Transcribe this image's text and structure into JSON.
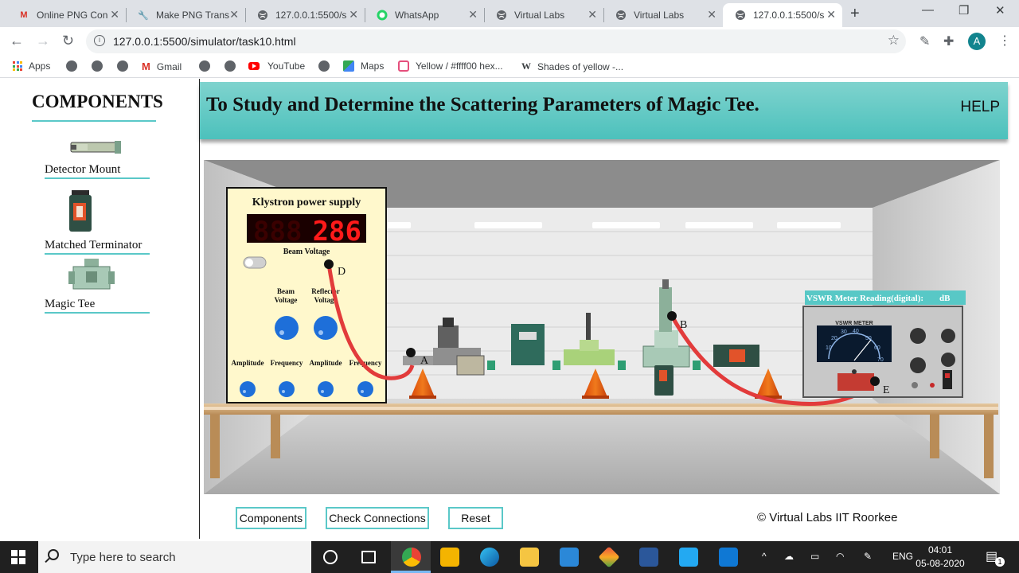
{
  "browser": {
    "tabs": [
      {
        "title": "Online PNG Con",
        "icon": "gmail-icon",
        "active": false
      },
      {
        "title": "Make PNG Trans",
        "icon": "wrench-icon",
        "active": false
      },
      {
        "title": "127.0.0.1:5500/s",
        "icon": "globe-icon",
        "active": false
      },
      {
        "title": "WhatsApp",
        "icon": "whatsapp-icon",
        "active": false
      },
      {
        "title": "Virtual Labs",
        "icon": "globe-icon",
        "active": false
      },
      {
        "title": "Virtual Labs",
        "icon": "globe-icon",
        "active": false
      },
      {
        "title": "127.0.0.1:5500/s",
        "icon": "globe-icon",
        "active": true
      }
    ],
    "url": "127.0.0.1:5500/simulator/task10.html",
    "bookmarks": [
      {
        "label": "Apps"
      },
      {
        "label": ""
      },
      {
        "label": ""
      },
      {
        "label": ""
      },
      {
        "label": "Gmail"
      },
      {
        "label": ""
      },
      {
        "label": ""
      },
      {
        "label": "YouTube"
      },
      {
        "label": ""
      },
      {
        "label": "Maps"
      },
      {
        "label": "Yellow / #ffff00 hex..."
      },
      {
        "label": "Shades of yellow -..."
      }
    ],
    "profile_initial": "A"
  },
  "sidebar": {
    "title": "COMPONENTS",
    "items": [
      {
        "label": "Detector Mount"
      },
      {
        "label": "Matched Terminator"
      },
      {
        "label": "Magic Tee"
      }
    ]
  },
  "header": {
    "title": "To Study and Determine the Scattering Parameters of Magic Tee.",
    "help": "HELP"
  },
  "klystron": {
    "title": "Klystron power supply",
    "display_value": "286",
    "display_label": "Beam Voltage",
    "knob_labels_top": [
      "Beam Voltage",
      "Reflector Voltage"
    ],
    "knob_labels_bottom": [
      "Amplitude",
      "Frequency",
      "Amplitude",
      "Frequency"
    ],
    "points": {
      "d": "D",
      "a": "A",
      "b": "B",
      "e": "E"
    }
  },
  "vswr": {
    "reading_label": "VSWR Meter Reading(digital):",
    "reading_unit": "dB",
    "meter_title": "VSWR METER",
    "scale": [
      "10",
      "20",
      "30",
      "40",
      "50",
      "60",
      "70"
    ]
  },
  "buttons": {
    "components": "Components",
    "check": "Check Connections",
    "reset": "Reset"
  },
  "footer": {
    "copyright": "© Virtual Labs IIT Roorkee"
  },
  "taskbar": {
    "search_placeholder": "Type here to search",
    "language": "ENG",
    "time": "04:01",
    "date": "05-08-2020",
    "notification_count": "1"
  }
}
